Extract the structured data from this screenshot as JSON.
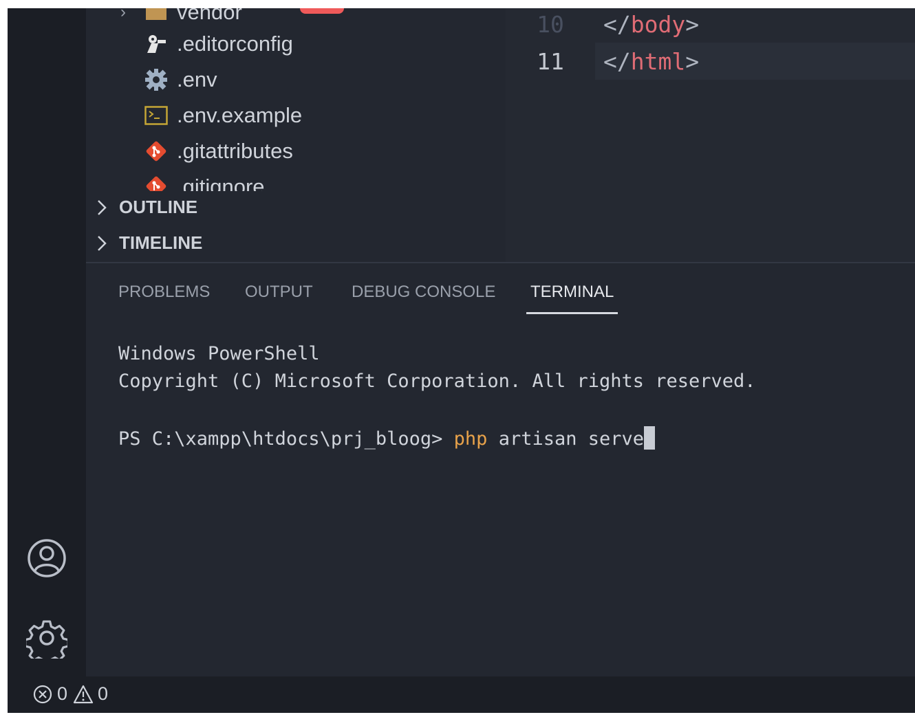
{
  "explorer": {
    "partial_top_item": "vendor",
    "files": [
      {
        "name": ".editorconfig",
        "icon": "editorconfig-icon"
      },
      {
        "name": ".env",
        "icon": "gear-icon"
      },
      {
        "name": ".env.example",
        "icon": "terminal-file-icon"
      },
      {
        "name": ".gitattributes",
        "icon": "git-icon"
      },
      {
        "name": ".gitignore",
        "icon": "git-icon"
      }
    ],
    "sections": [
      {
        "label": "OUTLINE"
      },
      {
        "label": "TIMELINE"
      }
    ]
  },
  "editor": {
    "lines": [
      {
        "number": "10",
        "open": "</",
        "tag": "body",
        "close": ">"
      },
      {
        "number": "11",
        "open": "</",
        "tag": "html",
        "close": ">"
      }
    ]
  },
  "panel": {
    "tabs": [
      {
        "label": "PROBLEMS"
      },
      {
        "label": "OUTPUT"
      },
      {
        "label": "DEBUG CONSOLE"
      },
      {
        "label": "TERMINAL",
        "active": true
      }
    ],
    "terminal": {
      "line1": "Windows PowerShell",
      "line2": "Copyright (C) Microsoft Corporation. All rights reserved.",
      "prompt": "PS C:\\xampp\\htdocs\\prj_bloog> ",
      "command": "php",
      "args": " artisan serve"
    }
  },
  "statusbar": {
    "errors": "0",
    "warnings": "0"
  },
  "colors": {
    "tag": "#e06c75",
    "command": "#e8a24a"
  }
}
